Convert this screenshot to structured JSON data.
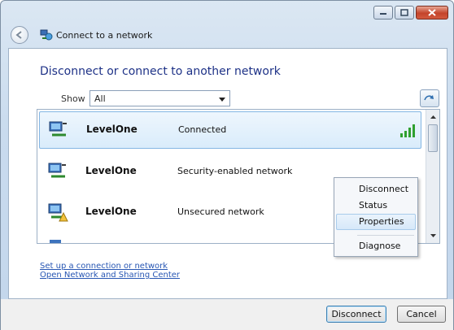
{
  "window": {
    "title": "Connect to a network"
  },
  "heading": "Disconnect or connect to another network",
  "show": {
    "label": "Show",
    "value": "All"
  },
  "networks": [
    {
      "name": "LevelOne",
      "status": "Connected"
    },
    {
      "name": "LevelOne",
      "status": "Security-enabled network"
    },
    {
      "name": "LevelOne",
      "status": "Unsecured network"
    }
  ],
  "context_menu": {
    "items": [
      "Disconnect",
      "Status",
      "Properties",
      "Diagnose"
    ],
    "highlighted": "Properties"
  },
  "links": {
    "setup": "Set up a connection or network",
    "sharing_center": "Open Network and Sharing Center"
  },
  "buttons": {
    "disconnect": "Disconnect",
    "cancel": "Cancel"
  },
  "colors": {
    "heading": "#1e3287",
    "link": "#2756b3",
    "signal": "#2fa02f",
    "selection": "#84b6e3"
  }
}
